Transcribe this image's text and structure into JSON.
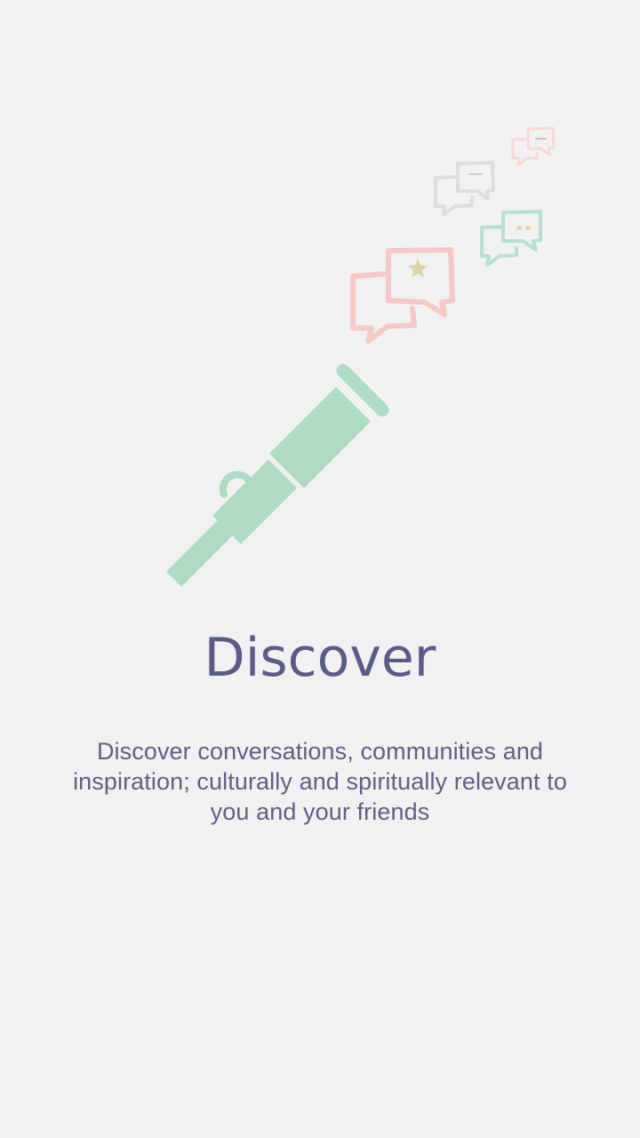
{
  "onboarding": {
    "title": "Discover",
    "description": "Discover conversations, communities and inspiration; culturally and spiritually relevant to you and your friends"
  },
  "illustration": {
    "icons": [
      "telescope-icon",
      "chat-bubbles-icon",
      "star-icon"
    ],
    "colors": {
      "telescope": "#aedbc3",
      "bubble_pink": "#f6c9c6",
      "bubble_grey": "#dddddd",
      "bubble_teal": "#b8dfd5",
      "star": "#ddd3a4"
    }
  },
  "theme": {
    "background": "#f1f1f1",
    "title_color": "#5b5b89",
    "text_color": "#5f5f86"
  }
}
